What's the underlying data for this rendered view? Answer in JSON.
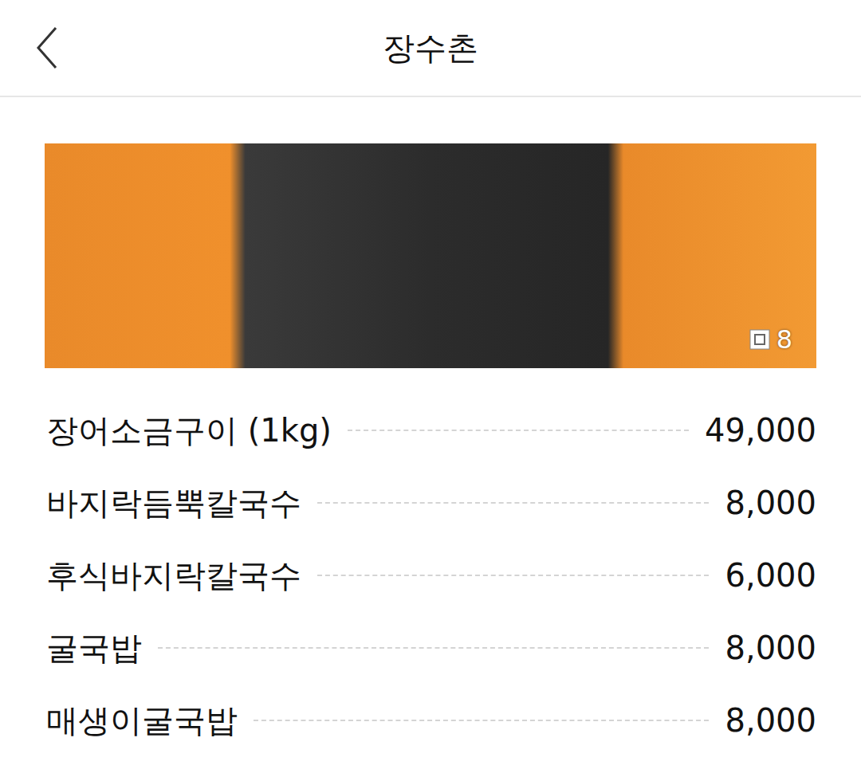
{
  "header": {
    "title": "장수촌"
  },
  "photo": {
    "count": "8"
  },
  "menu": [
    {
      "name": "장어소금구이 (1kg)",
      "price": "49,000"
    },
    {
      "name": "바지락듬뿍칼국수",
      "price": "8,000"
    },
    {
      "name": "후식바지락칼국수",
      "price": "6,000"
    },
    {
      "name": "굴국밥",
      "price": "8,000"
    },
    {
      "name": "매생이굴국밥",
      "price": "8,000"
    }
  ]
}
